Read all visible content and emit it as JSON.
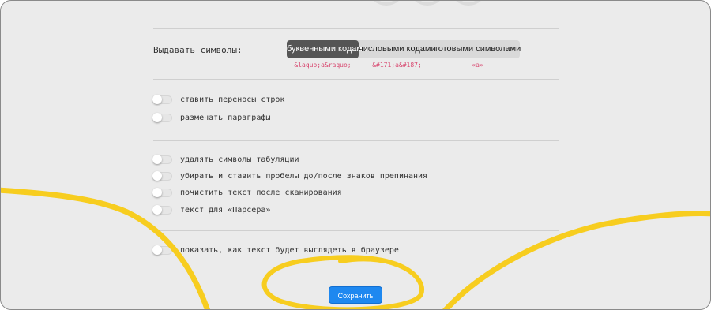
{
  "settings": {
    "output_label": "Выдавать символы:",
    "modes": [
      {
        "label": "буквенными кодами",
        "example": "&laquo;a&raquo;",
        "active": true
      },
      {
        "label": "числовыми кодами",
        "example": "&#171;a&#187;",
        "active": false
      },
      {
        "label": "готовыми символами",
        "example": "«a»",
        "active": false
      }
    ],
    "group1": [
      {
        "label": "ставить переносы строк",
        "enabled": false
      },
      {
        "label": "размечать параграфы",
        "enabled": false
      }
    ],
    "group2": [
      {
        "label": "удалять символы табуляции",
        "enabled": false
      },
      {
        "label": "убирать и ставить пробелы до/после знаков препинания",
        "enabled": false
      },
      {
        "label": "почистить текст после сканирования",
        "enabled": false
      },
      {
        "label": "текст для «Парсера»",
        "enabled": false
      }
    ],
    "group3": [
      {
        "label": "показать, как текст будет выглядеть в браузере",
        "enabled": false
      }
    ],
    "save_label": "Сохранить"
  },
  "colors": {
    "accent": "#1e88f0",
    "active_segment": "#555555",
    "example_text": "#d8476f",
    "decoration": "#f7cd1f"
  }
}
